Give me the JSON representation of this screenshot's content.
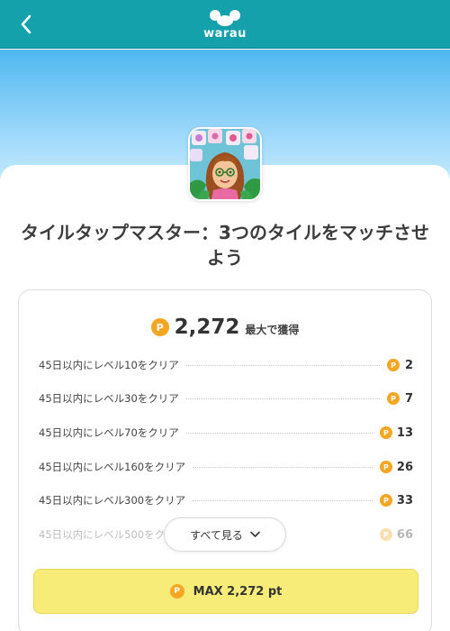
{
  "header": {
    "back_icon": "chevron-left-icon",
    "logo_text": "warau",
    "brand_color": "#14a1ac"
  },
  "app": {
    "icon": "tile-tap-master-app-icon",
    "title": "タイルタップマスター：3つのタイルをマッチさせよう"
  },
  "reward": {
    "coin_symbol": "P",
    "total": "2,272",
    "total_suffix": "最大で獲得",
    "tasks": [
      {
        "label": "45日以内にレベル10をクリア",
        "points": "2"
      },
      {
        "label": "45日以内にレベル30をクリア",
        "points": "7"
      },
      {
        "label": "45日以内にレベル70をクリア",
        "points": "13"
      },
      {
        "label": "45日以内にレベル160をクリア",
        "points": "26"
      },
      {
        "label": "45日以内にレベル300をクリア",
        "points": "33"
      },
      {
        "label": "45日以内にレベル500をクリア",
        "points": "66"
      }
    ],
    "see_all_label": "すべて見る",
    "max_button_label": "MAX 2,272 pt",
    "coin_color": "#f5a623",
    "button_color": "#f7ec77"
  }
}
